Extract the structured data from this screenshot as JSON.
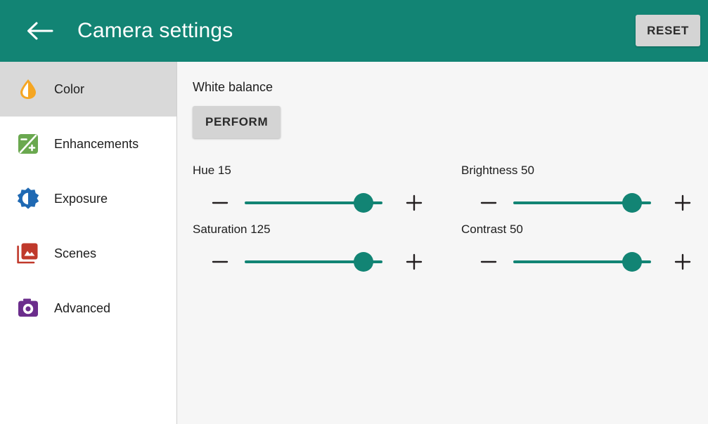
{
  "header": {
    "back_icon": "arrow-left-icon",
    "title": "Camera settings",
    "reset_label": "RESET",
    "bar_color": "#128474",
    "title_color": "#ffffff"
  },
  "sidebar": {
    "items": [
      {
        "label": "Color",
        "icon": "color-droplet-icon",
        "color": "#f5a623",
        "selected": true
      },
      {
        "label": "Enhancements",
        "icon": "enhancements-icon",
        "color": "#6aa84f",
        "selected": false
      },
      {
        "label": "Exposure",
        "icon": "exposure-icon",
        "color": "#1f69b3",
        "selected": false
      },
      {
        "label": "Scenes",
        "icon": "scenes-icon",
        "color": "#c0392b",
        "selected": false
      },
      {
        "label": "Advanced",
        "icon": "advanced-camera-icon",
        "color": "#6b2d8c",
        "selected": false
      }
    ],
    "selected_bg": "#d9d9d9"
  },
  "content": {
    "white_balance_label": "White balance",
    "perform_label": "PERFORM",
    "accent_color": "#128474",
    "sliders": [
      {
        "name": "Hue",
        "value": "15",
        "label": "Hue 15",
        "percent": 86
      },
      {
        "name": "Brightness",
        "value": "50",
        "label": "Brightness 50",
        "percent": 86
      },
      {
        "name": "Saturation",
        "value": "125",
        "label": "Saturation 125",
        "percent": 86
      },
      {
        "name": "Contrast",
        "value": "50",
        "label": "Contrast 50",
        "percent": 86
      }
    ],
    "decrement_icon": "minus-icon",
    "increment_icon": "plus-icon"
  }
}
